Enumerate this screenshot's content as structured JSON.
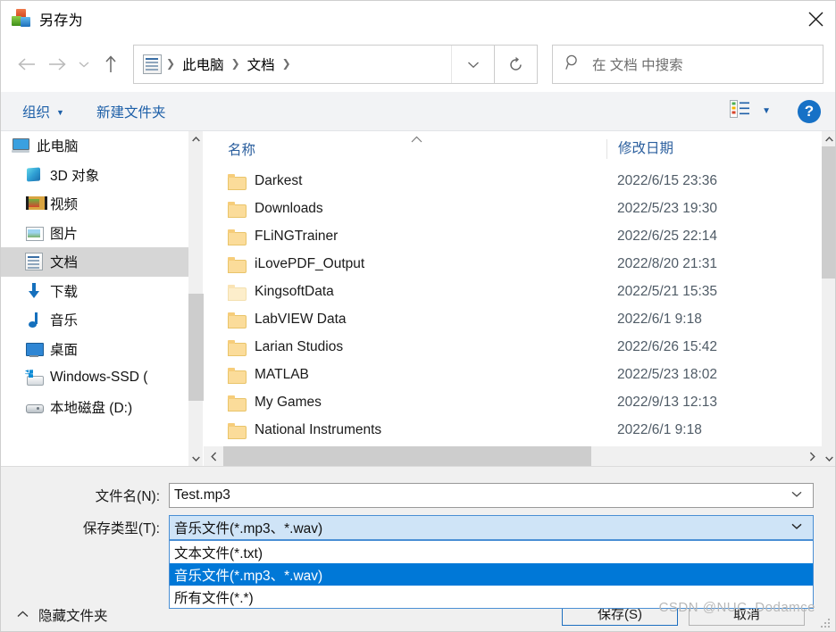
{
  "window": {
    "title": "另存为",
    "app_icon": "save-as-app-icon",
    "close_label": "✕"
  },
  "nav": {
    "back_icon": "arrow-left-icon",
    "forward_icon": "arrow-right-icon",
    "recent_icon": "chevron-down-icon",
    "up_icon": "arrow-up-icon",
    "address_icon": "documents-folder-icon",
    "breadcrumbs": [
      "此电脑",
      "文档"
    ],
    "separator": "❯",
    "address_dropdown_icon": "chevron-down-icon",
    "refresh_icon": "refresh-icon"
  },
  "search": {
    "icon": "search-icon",
    "placeholder": "在 文档 中搜索"
  },
  "commandbar": {
    "organize_label": "组织",
    "organize_caret": "▼",
    "new_folder_label": "新建文件夹",
    "view_icon": "view-list-icon",
    "view_caret": "▼",
    "help_label": "?"
  },
  "sidebar": {
    "scroll_up_icon": "chevron-up-icon",
    "scroll_down_icon": "chevron-down-icon",
    "items": [
      {
        "label": "此电脑",
        "icon": "this-pc-icon",
        "selected": false,
        "root": true
      },
      {
        "label": "3D 对象",
        "icon": "3d-objects-icon",
        "selected": false,
        "root": false
      },
      {
        "label": "视频",
        "icon": "videos-icon",
        "selected": false,
        "root": false
      },
      {
        "label": "图片",
        "icon": "pictures-icon",
        "selected": false,
        "root": false
      },
      {
        "label": "文档",
        "icon": "documents-icon",
        "selected": true,
        "root": false
      },
      {
        "label": "下载",
        "icon": "downloads-icon",
        "selected": false,
        "root": false
      },
      {
        "label": "音乐",
        "icon": "music-icon",
        "selected": false,
        "root": false
      },
      {
        "label": "桌面",
        "icon": "desktop-icon",
        "selected": false,
        "root": false
      },
      {
        "label": "Windows-SSD (",
        "icon": "windows-ssd-icon",
        "selected": false,
        "root": false
      },
      {
        "label": "本地磁盘 (D:)",
        "icon": "local-disk-icon",
        "selected": false,
        "root": false
      }
    ]
  },
  "filelist": {
    "columns": [
      "名称",
      "修改日期"
    ],
    "sort_caret": "^",
    "rows": [
      {
        "name": "Darkest",
        "date": "2022/6/15 23:36",
        "icon": "folder-icon"
      },
      {
        "name": "Downloads",
        "date": "2022/5/23 19:30",
        "icon": "folder-icon"
      },
      {
        "name": "FLiNGTrainer",
        "date": "2022/6/25 22:14",
        "icon": "folder-icon"
      },
      {
        "name": "iLovePDF_Output",
        "date": "2022/8/20 21:31",
        "icon": "folder-icon"
      },
      {
        "name": "KingsoftData",
        "date": "2022/5/21 15:35",
        "icon": "folder-icon-pale"
      },
      {
        "name": "LabVIEW Data",
        "date": "2022/6/1 9:18",
        "icon": "folder-icon"
      },
      {
        "name": "Larian Studios",
        "date": "2022/6/26 15:42",
        "icon": "folder-icon"
      },
      {
        "name": "MATLAB",
        "date": "2022/5/23 18:02",
        "icon": "folder-icon"
      },
      {
        "name": "My Games",
        "date": "2022/9/13 12:13",
        "icon": "folder-icon"
      },
      {
        "name": "National Instruments",
        "date": "2022/6/1 9:18",
        "icon": "folder-icon"
      }
    ],
    "hscroll_left_icon": "chevron-left-icon",
    "hscroll_right_icon": "chevron-right-icon"
  },
  "form": {
    "filename_label": "文件名(N):",
    "filename_value": "Test.mp3",
    "filename_caret": "▼",
    "filetype_label": "保存类型(T):",
    "filetype_value": "音乐文件(*.mp3、*.wav)",
    "filetype_caret": "▼",
    "filetype_options": [
      {
        "label": "文本文件(*.txt)",
        "highlighted": false
      },
      {
        "label": "音乐文件(*.mp3、*.wav)",
        "highlighted": true
      },
      {
        "label": "所有文件(*.*)",
        "highlighted": false
      }
    ]
  },
  "footer": {
    "hide_folders_caret": "^",
    "hide_folders_label": "隐藏文件夹",
    "save_label": "保存(S)",
    "cancel_label": "取消"
  },
  "watermark": {
    "text": "CSDN @NUC_Dodamce"
  },
  "colors": {
    "accent_blue": "#0078d7",
    "link_blue": "#1d5fa8",
    "combo_focus_border": "#4a8fd4",
    "combo_focus_fill": "#cfe4f7",
    "selection_gray": "#d6d6d6",
    "chrome_gray": "#f0f0f0",
    "cmdbar_gray": "#f2f3f5"
  }
}
